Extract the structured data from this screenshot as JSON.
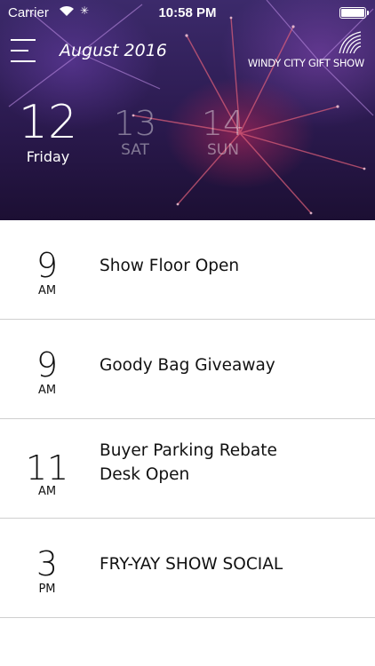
{
  "status_bar": {
    "carrier": "Carrier",
    "time": "10:58 PM"
  },
  "header": {
    "month": "August 2016",
    "logo_text": "WINDY CITY GIFT SHOW",
    "menu_icon": "hamburger-menu-icon"
  },
  "days": [
    {
      "number": "12",
      "label": "Friday",
      "selected": true
    },
    {
      "number": "13",
      "label": "SAT",
      "selected": false
    },
    {
      "number": "14",
      "label": "SUN",
      "selected": false
    }
  ],
  "events": [
    {
      "hour": "9",
      "ampm": "AM",
      "title": "Show Floor Open"
    },
    {
      "hour": "9",
      "ampm": "AM",
      "title": "Goody Bag Giveaway"
    },
    {
      "hour": "11",
      "ampm": "AM",
      "title": "Buyer Parking Rebate Desk Open"
    },
    {
      "hour": "3",
      "ampm": "PM",
      "title": "FRY-YAY SHOW SOCIAL"
    }
  ],
  "colors": {
    "header_bg": "#2b1a4f",
    "accent": "#c8285a",
    "divider": "#cfcfcf"
  }
}
